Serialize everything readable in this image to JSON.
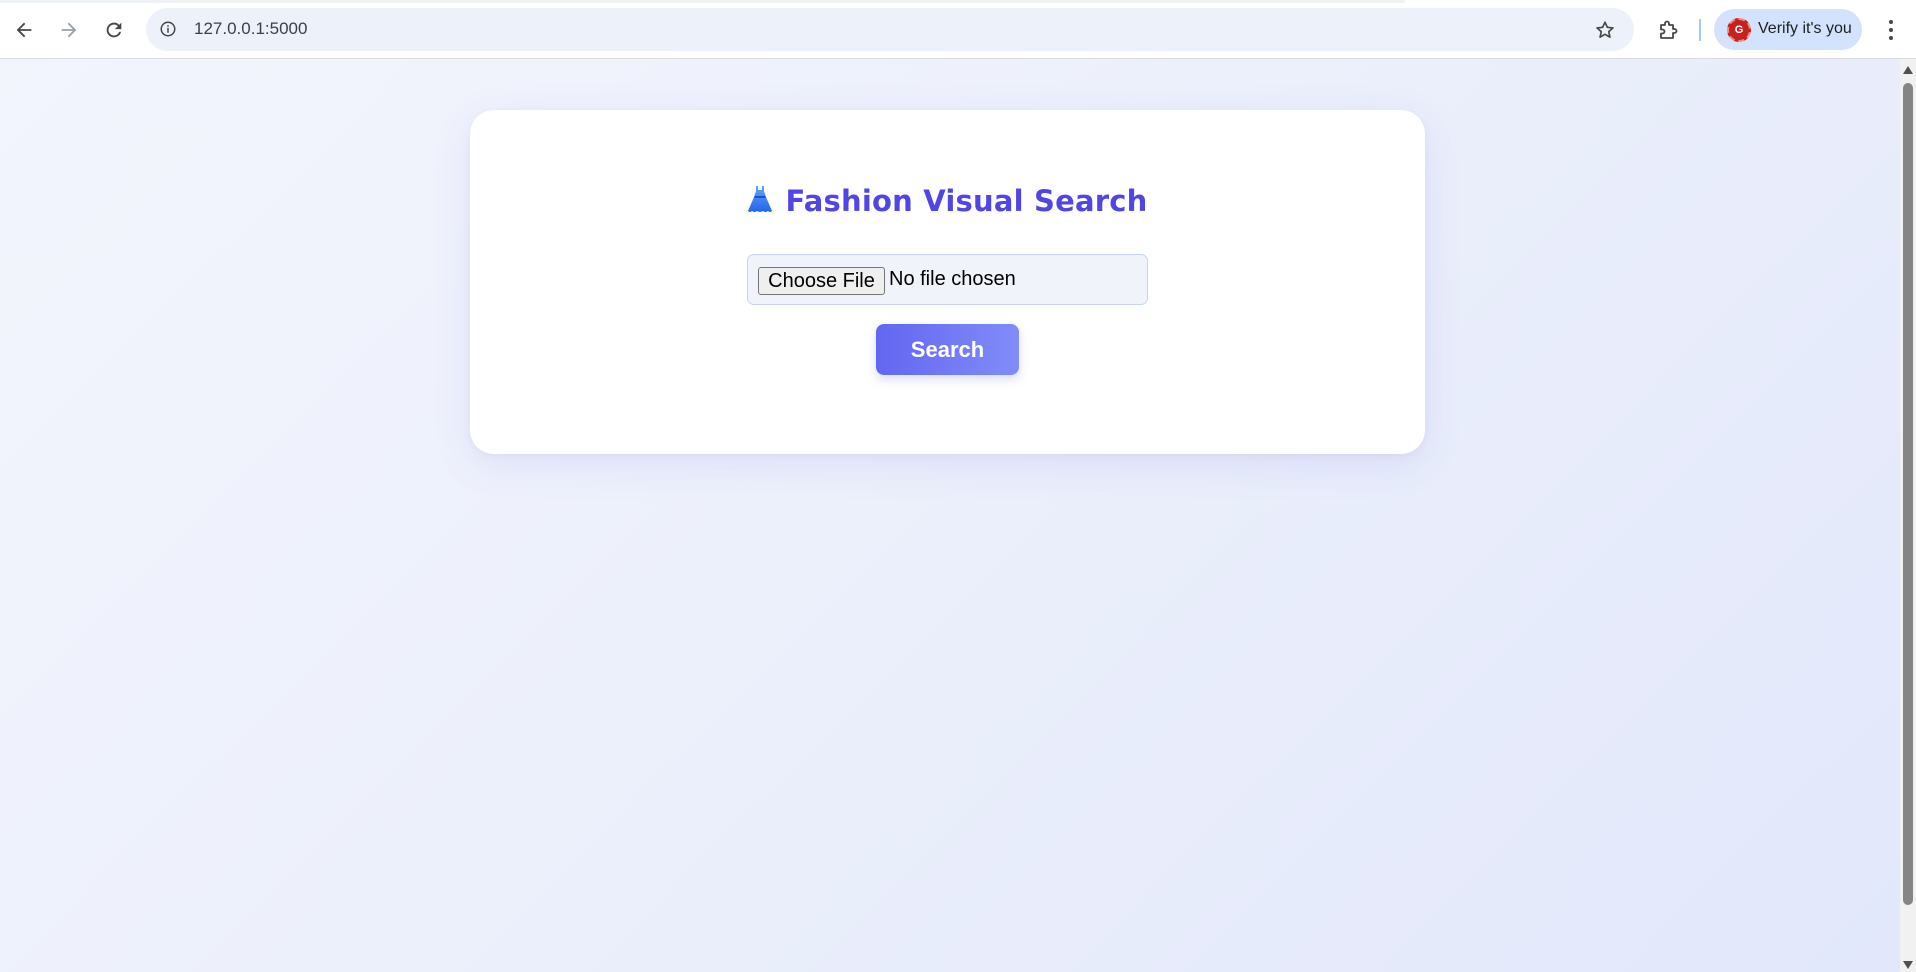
{
  "browser": {
    "url": "127.0.0.1:5000",
    "profile_label": "Verify it's you",
    "profile_initial": "G",
    "icons": {
      "back": "arrow-left-icon",
      "forward": "arrow-right-icon",
      "reload": "reload-icon",
      "site_info": "info-icon",
      "bookmark": "star-icon",
      "extensions": "puzzle-icon",
      "menu": "kebab-menu-icon"
    }
  },
  "page": {
    "title": "Fashion Visual Search",
    "title_icon": "dress-icon",
    "file_input": {
      "button_label": "Choose File",
      "status": "No file chosen"
    },
    "search_label": "Search"
  },
  "colors": {
    "accent": "#4f46e5",
    "button_gradient_start": "#6366f1",
    "button_gradient_end": "#818cf8",
    "background": "#eceffb"
  }
}
